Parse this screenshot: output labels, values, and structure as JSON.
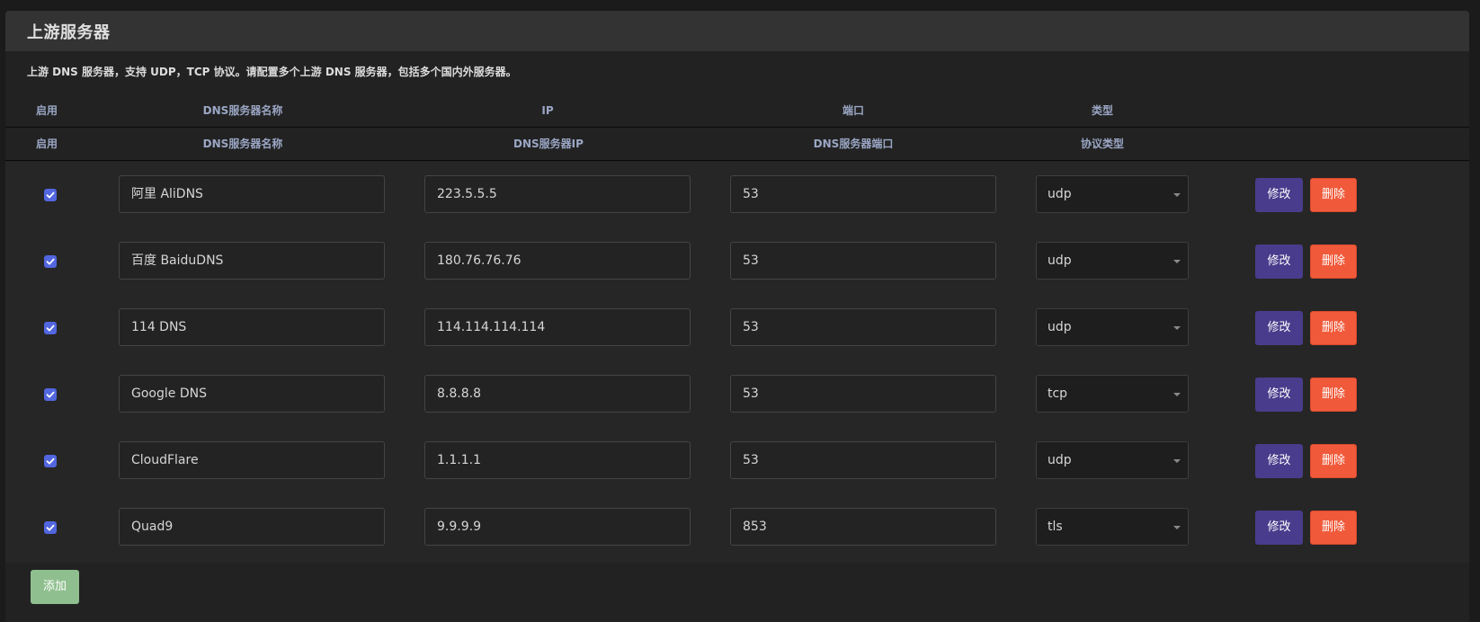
{
  "panel": {
    "title": "上游服务器",
    "description": "上游 DNS 服务器，支持 UDP，TCP 协议。请配置多个上游 DNS 服务器，包括多个国内外服务器。"
  },
  "header1": {
    "enabled": "启用",
    "name": "DNS服务器名称",
    "ip": "IP",
    "port": "端口",
    "type": "类型"
  },
  "header2": {
    "enabled": "启用",
    "name": "DNS服务器名称",
    "ip": "DNS服务器IP",
    "port": "DNS服务器端口",
    "type": "协议类型"
  },
  "servers": [
    {
      "enabled": true,
      "name": "阿里 AliDNS",
      "ip": "223.5.5.5",
      "port": "53",
      "type": "udp"
    },
    {
      "enabled": true,
      "name": "百度 BaiduDNS",
      "ip": "180.76.76.76",
      "port": "53",
      "type": "udp"
    },
    {
      "enabled": true,
      "name": "114 DNS",
      "ip": "114.114.114.114",
      "port": "53",
      "type": "udp"
    },
    {
      "enabled": true,
      "name": "Google DNS",
      "ip": "8.8.8.8",
      "port": "53",
      "type": "tcp"
    },
    {
      "enabled": true,
      "name": "CloudFlare",
      "ip": "1.1.1.1",
      "port": "53",
      "type": "udp"
    },
    {
      "enabled": true,
      "name": "Quad9",
      "ip": "9.9.9.9",
      "port": "853",
      "type": "tls"
    }
  ],
  "actions": {
    "edit_label": "修改",
    "delete_label": "删除",
    "add_label": "添加"
  },
  "colors": {
    "edit_button": "#4a3c8c",
    "delete_button": "#f05a3a",
    "add_button": "#8fbf8f",
    "checkbox": "#5266e0",
    "header_text": "#9aa6c4"
  }
}
